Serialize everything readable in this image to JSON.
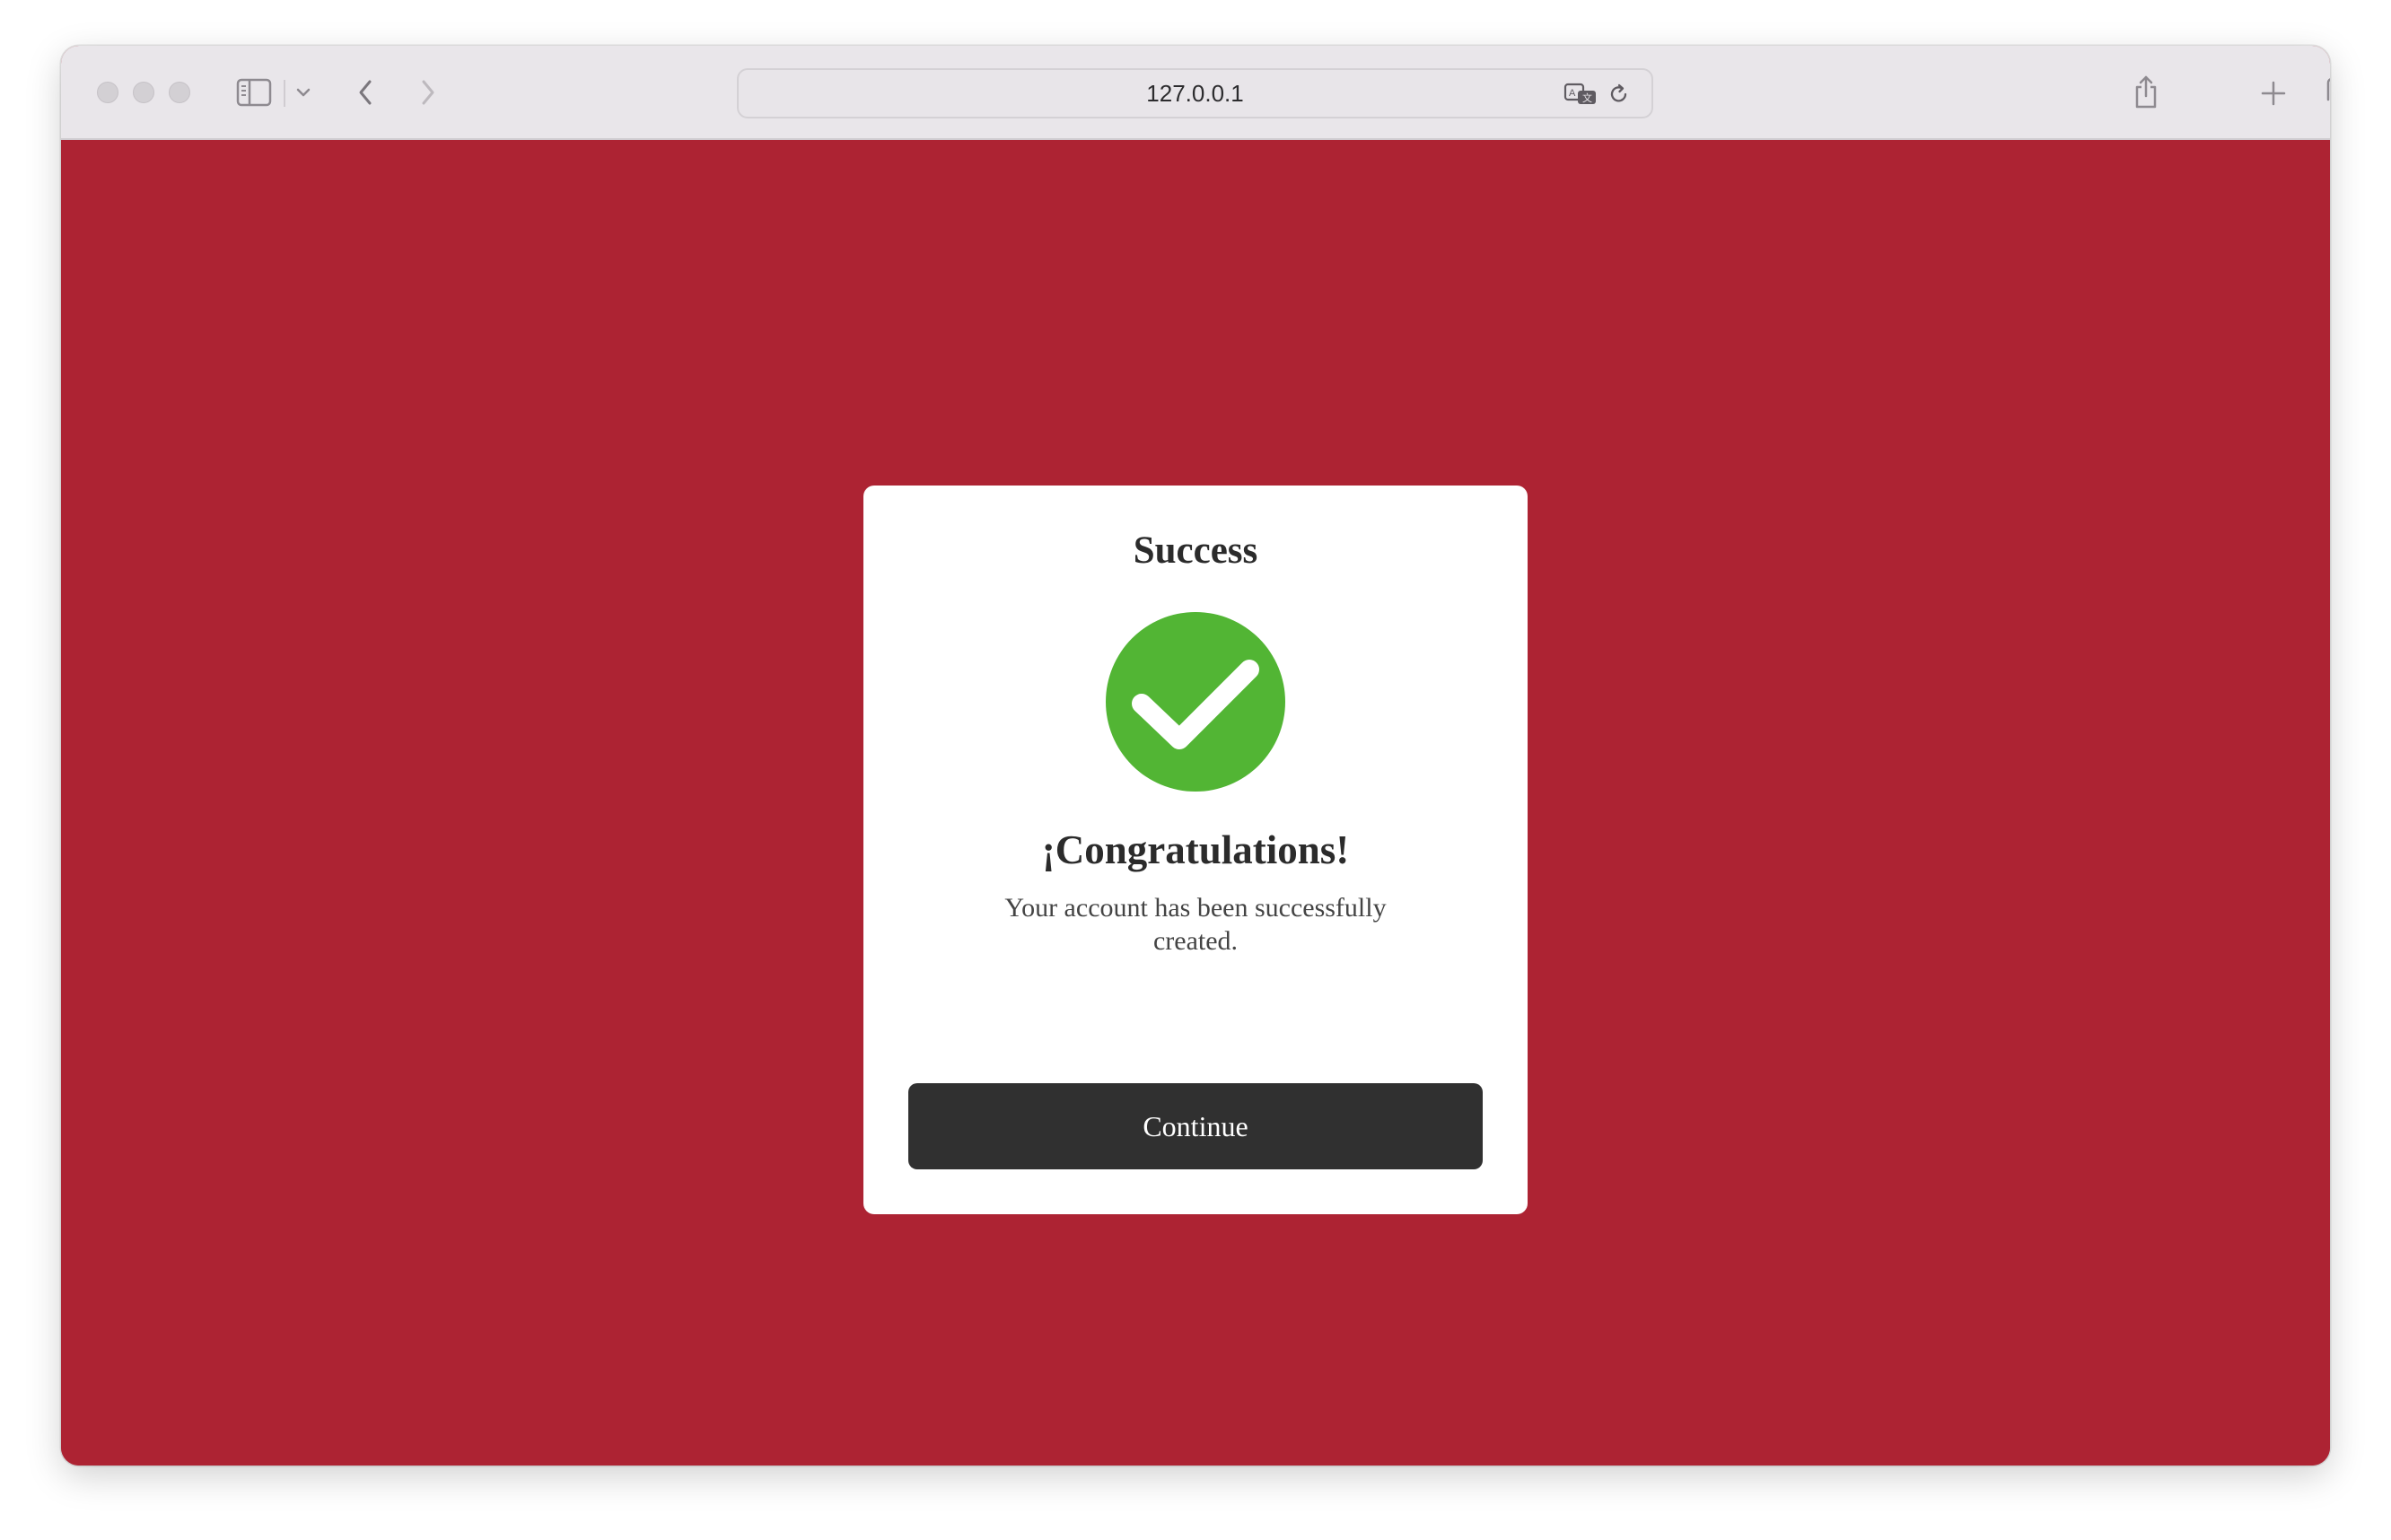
{
  "browser": {
    "url": "127.0.0.1",
    "icons": {
      "sidebar": "sidebar-icon",
      "sidebar_menu": "chevron-down-icon",
      "back": "chevron-left-icon",
      "forward": "chevron-right-icon",
      "translate": "translate-icon",
      "reload": "reload-icon",
      "share": "share-icon",
      "new_tab": "plus-icon",
      "tab_overview": "tabs-icon"
    }
  },
  "page": {
    "background_color": "#ad2333"
  },
  "dialog": {
    "title": "Success",
    "icon": "checkmark-circle-icon",
    "icon_color": "#52b534",
    "heading": "¡Congratulations!",
    "message": "Your account has been successfully created.",
    "button_label": "Continue"
  }
}
